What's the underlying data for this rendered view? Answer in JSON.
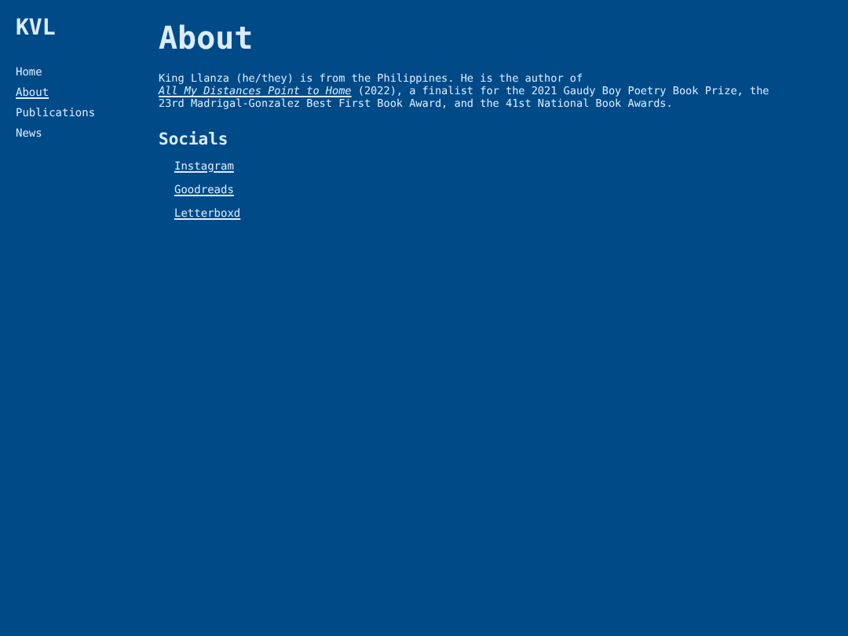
{
  "site_title": "KVL",
  "nav": [
    {
      "label": "Home",
      "selected": false
    },
    {
      "label": "About",
      "selected": true
    },
    {
      "label": "Publications",
      "selected": false
    },
    {
      "label": "News",
      "selected": false
    }
  ],
  "page_title": "About",
  "bio": {
    "before": "King Llanza (he/they) is from the Philippines. He is the author of ",
    "link": "All My Distances Point to Home",
    "after": " (2022), a finalist for the 2021 Gaudy Boy Poetry Book Prize, the 23rd Madrigal-Gonzalez Best First Book Award, and the 41st National Book Awards."
  },
  "socials": {
    "heading": "Socials",
    "links": [
      "Instagram",
      "Goodreads",
      "Letterboxd"
    ]
  }
}
